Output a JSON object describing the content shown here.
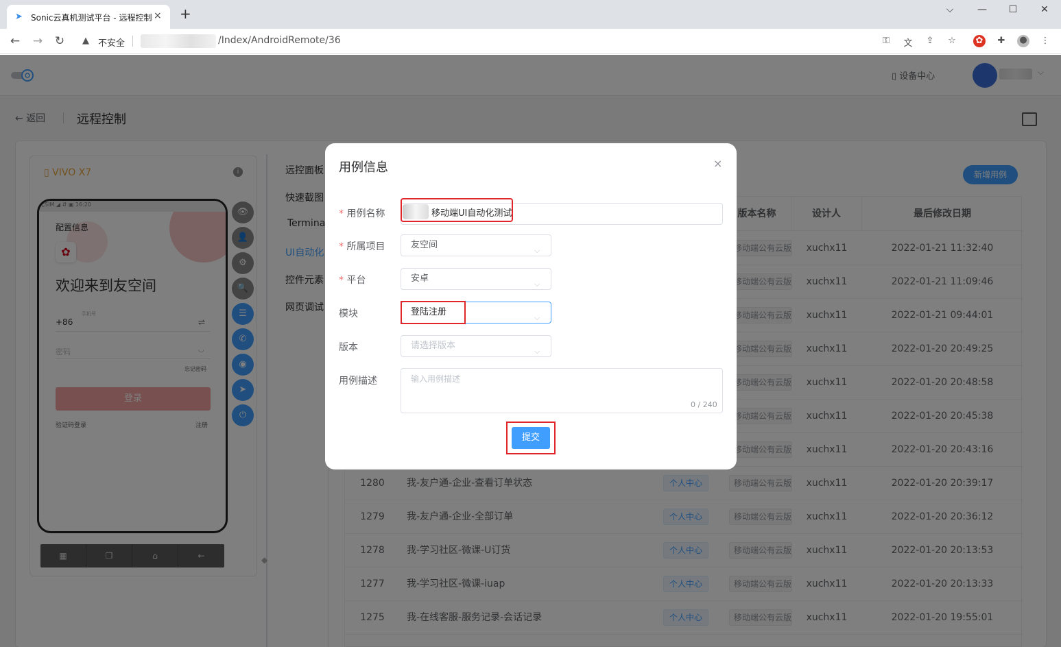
{
  "browser": {
    "tab_title": "Sonic云真机测试平台 - 远程控制",
    "new_tab_label": "+",
    "insecure_label": "不安全",
    "url_path": "/Index/AndroidRemote/36",
    "window_buttons": [
      "⌵",
      "—",
      "☐",
      "✕"
    ]
  },
  "header": {
    "device_center_label": "设备中心",
    "back_label": "返回",
    "page_title": "远程控制"
  },
  "device": {
    "name": "VIVO X7",
    "status_bar": "无SIM ◢ ⇵ ▣          16:20",
    "screen": {
      "config_label": "配置信息",
      "welcome": "欢迎来到友空间",
      "country_code": "+86",
      "phone_label": "手机号",
      "password_placeholder": "密码",
      "forgot": "忘记密码",
      "login": "登录",
      "sms_login": "验证码登录",
      "register": "注册"
    },
    "side_buttons": [
      "👁",
      "👤",
      "⚙",
      "🔍",
      "☰",
      "✆",
      "◉",
      "➤",
      "⏻"
    ],
    "nav_buttons": [
      "▦",
      "❐",
      "⌂",
      "←"
    ]
  },
  "left_tabs": [
    "远控面板",
    "快速截图",
    "Terminal",
    "UI自动化",
    "控件元素",
    "网页调试"
  ],
  "table": {
    "add_button": "新增用例",
    "headers": [
      "",
      "",
      "",
      "版本名称",
      "设计人",
      "最后修改日期"
    ],
    "rows": [
      {
        "id": "",
        "name": "",
        "module": "",
        "version": "移动端公有云版",
        "designer": "xuchx11",
        "date": "2022-01-21 11:32:40"
      },
      {
        "id": "",
        "name": "",
        "module": "",
        "version": "移动端公有云版",
        "designer": "xuchx11",
        "date": "2022-01-21 11:09:46"
      },
      {
        "id": "",
        "name": "",
        "module": "",
        "version": "移动端公有云版",
        "designer": "xuchx11",
        "date": "2022-01-21 09:44:01"
      },
      {
        "id": "",
        "name": "",
        "module": "",
        "version": "移动端公有云版",
        "designer": "xuchx11",
        "date": "2022-01-20 20:49:25"
      },
      {
        "id": "",
        "name": "",
        "module": "",
        "version": "移动端公有云版",
        "designer": "xuchx11",
        "date": "2022-01-20 20:48:58"
      },
      {
        "id": "",
        "name": "",
        "module": "",
        "version": "移动端公有云版",
        "designer": "xuchx11",
        "date": "2022-01-20 20:45:38"
      },
      {
        "id": "",
        "name": "",
        "module": "",
        "version": "移动端公有云版",
        "designer": "xuchx11",
        "date": "2022-01-20 20:43:16"
      },
      {
        "id": "1280",
        "name": "我-友户通-企业-查看订单状态",
        "module": "个人中心",
        "version": "移动端公有云版",
        "designer": "xuchx11",
        "date": "2022-01-20 20:39:17"
      },
      {
        "id": "1279",
        "name": "我-友户通-企业-全部订单",
        "module": "个人中心",
        "version": "移动端公有云版",
        "designer": "xuchx11",
        "date": "2022-01-20 20:36:12"
      },
      {
        "id": "1278",
        "name": "我-学习社区-微课-U订货",
        "module": "个人中心",
        "version": "移动端公有云版",
        "designer": "xuchx11",
        "date": "2022-01-20 20:13:53"
      },
      {
        "id": "1277",
        "name": "我-学习社区-微课-iuap",
        "module": "个人中心",
        "version": "移动端公有云版",
        "designer": "xuchx11",
        "date": "2022-01-20 20:13:33"
      },
      {
        "id": "1275",
        "name": "我-在线客服-服务记录-会话记录",
        "module": "个人中心",
        "version": "移动端公有云版",
        "designer": "xuchx11",
        "date": "2022-01-20 19:55:01"
      }
    ]
  },
  "dialog": {
    "title": "用例信息",
    "close": "×",
    "name_label": "用例名称",
    "name_value": "移动端UI自动化测试",
    "project_label": "所属项目",
    "project_value": "友空间",
    "platform_label": "平台",
    "platform_value": "安卓",
    "module_label": "模块",
    "module_value": "登陆注册",
    "version_label": "版本",
    "version_placeholder": "请选择版本",
    "desc_label": "用例描述",
    "desc_placeholder": "输入用例描述",
    "desc_count": "0 / 240",
    "submit": "提交"
  },
  "colors": {
    "primary": "#409eff",
    "highlight_box": "#e0262b",
    "required": "#f56c6c",
    "device_name": "#e6a23c"
  }
}
